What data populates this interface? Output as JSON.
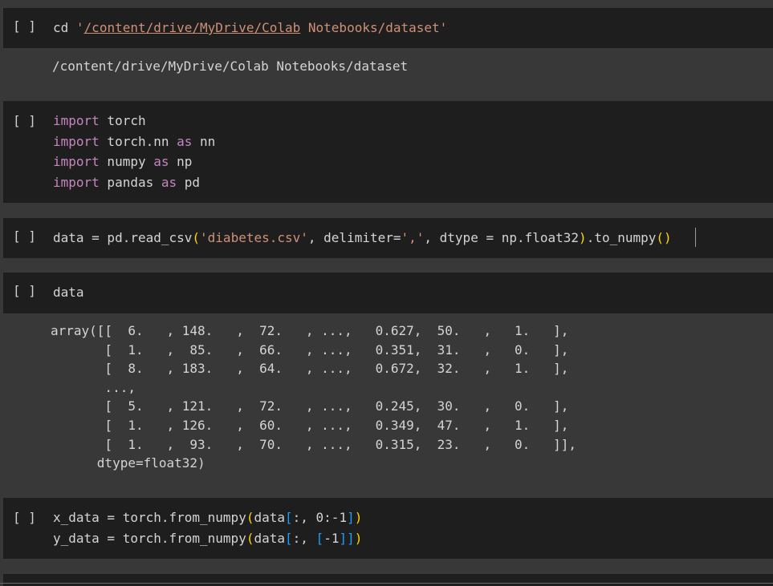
{
  "run_button_label": "[ ]",
  "cells": {
    "cd": {
      "cmd": "cd",
      "quote_open": "'",
      "path_link": "/content/drive/MyDrive/Colab",
      "path_rest": " Notebooks/dataset",
      "quote_close": "'",
      "output": "/content/drive/MyDrive/Colab Notebooks/dataset"
    },
    "imports": {
      "kw_import": "import",
      "kw_as": "as",
      "l1_mod": " torch",
      "l2_mod": " torch.nn ",
      "l2_alias": " nn",
      "l3_mod": " numpy ",
      "l3_alias": " np",
      "l4_mod": " pandas ",
      "l4_alias": " pd"
    },
    "read_csv": {
      "lhs": "data = pd.read_csv",
      "paren_open": "(",
      "arg1": "'diabetes.csv'",
      "mid1": ", delimiter=",
      "arg2": "','",
      "mid2": ", dtype = np.float32",
      "paren_close": ")",
      "tail": ".to_numpy",
      "call": "()"
    },
    "data": {
      "code": "data",
      "output_lines": [
        "array([[  6.   , 148.   ,  72.   , ...,   0.627,  50.   ,   1.   ],",
        "       [  1.   ,  85.   ,  66.   , ...,   0.351,  31.   ,   0.   ],",
        "       [  8.   , 183.   ,  64.   , ...,   0.672,  32.   ,   1.   ],",
        "       ...,",
        "       [  5.   , 121.   ,  72.   , ...,   0.245,  30.   ,   0.   ],",
        "       [  1.   , 126.   ,  60.   , ...,   0.349,  47.   ,   1.   ],",
        "       [  1.   ,  93.   ,  70.   , ...,   0.315,  23.   ,   0.   ]],",
        "      dtype=float32)"
      ]
    },
    "split": {
      "x_lhs": "x_data = torch.from_numpy",
      "x_open": "(",
      "x_arg_a": "data",
      "x_sq_open": "[",
      "x_slice": ":, 0:-1",
      "x_sq_close": "]",
      "x_close": ")",
      "y_lhs": "y_data = torch.from_numpy",
      "y_open": "(",
      "y_arg_a": "data",
      "y_sq_open": "[",
      "y_slice_a": ":, ",
      "y_inner_open": "[",
      "y_inner_val": "-1",
      "y_inner_close": "]",
      "y_sq_close": "]",
      "y_close": ")"
    }
  },
  "colors": {
    "cell_bg": "#1e1e1e",
    "page_bg": "#383838",
    "keyword": "#c586c0",
    "string": "#ce9178",
    "bracket_gold": "#ffd700",
    "bracket_blue": "#179fff"
  }
}
